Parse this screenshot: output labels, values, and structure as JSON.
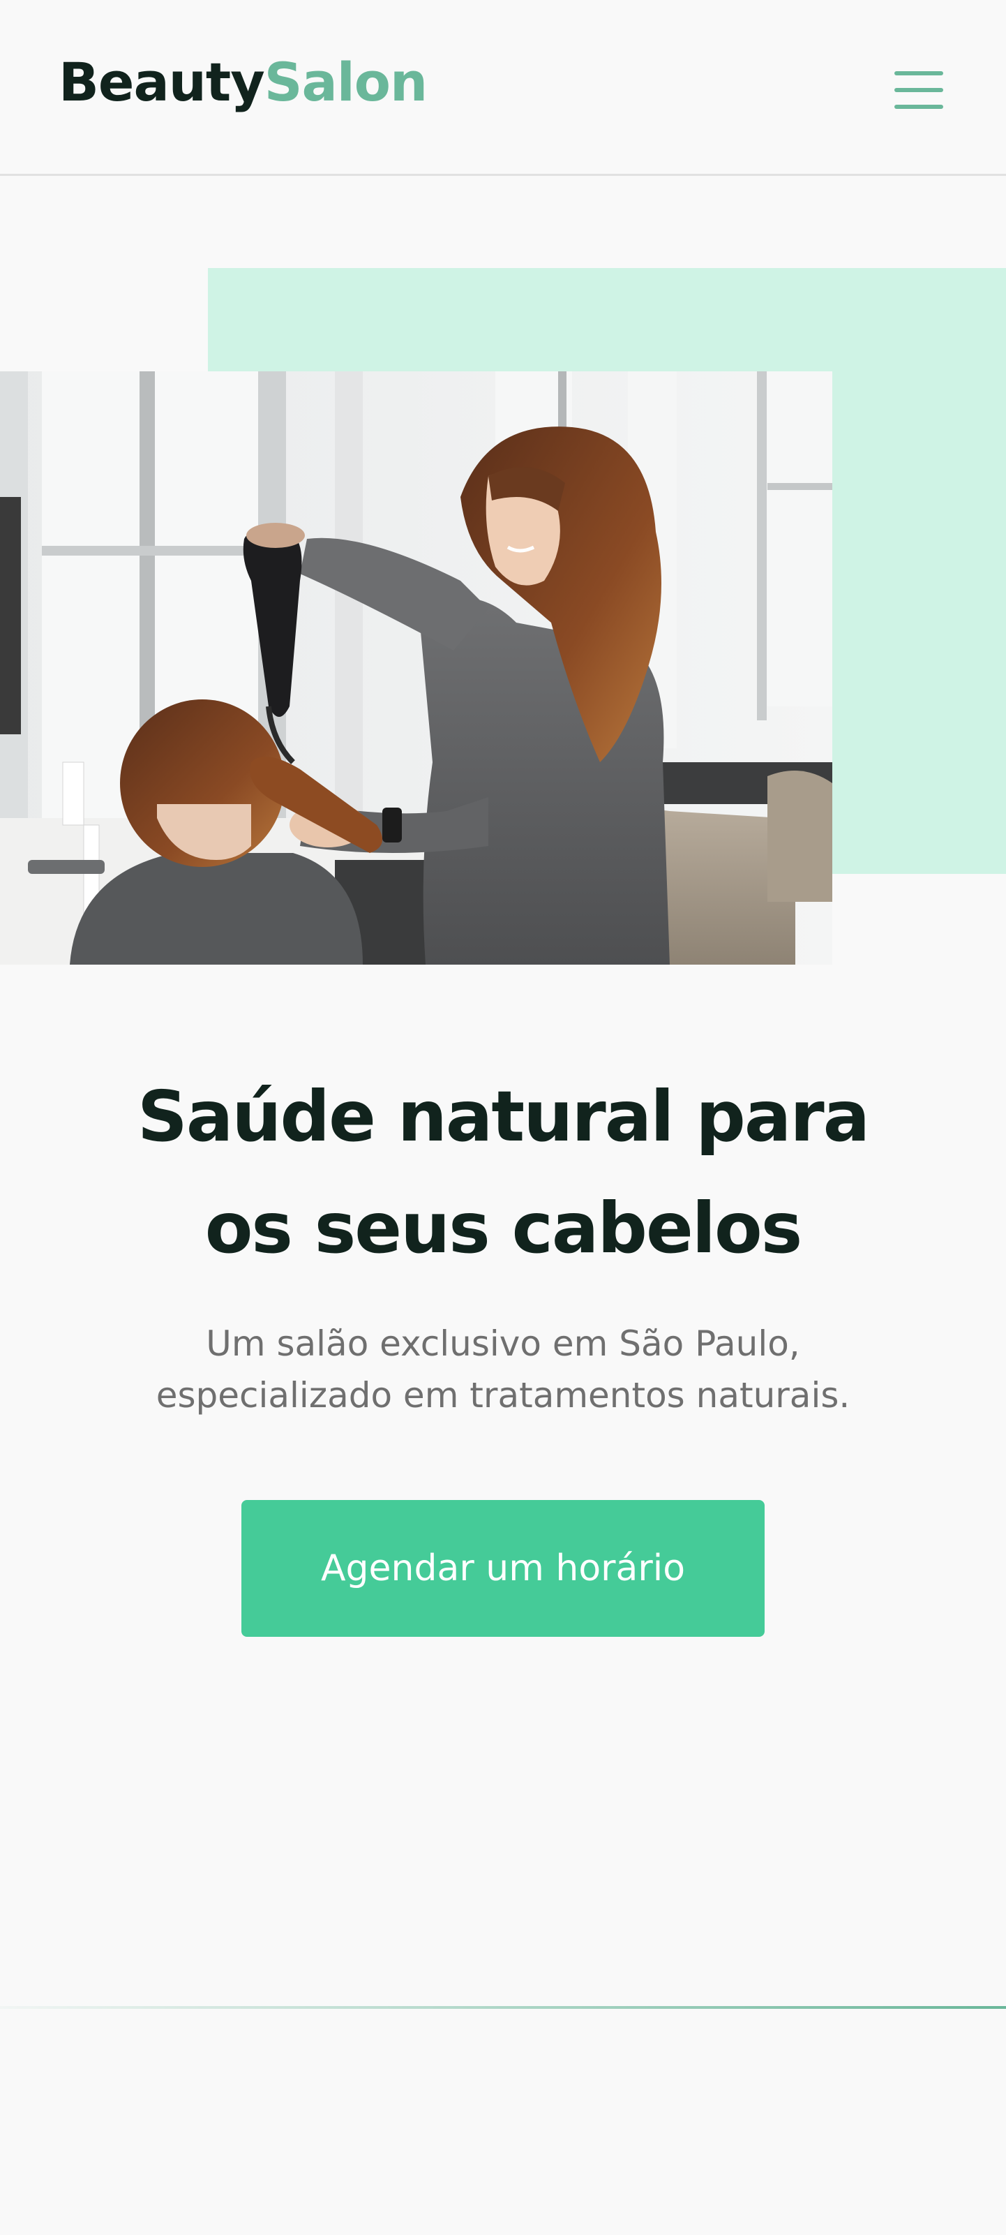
{
  "header": {
    "logo_part1": "Beauty",
    "logo_part2": "Salon"
  },
  "icons": {
    "menu": "hamburger-menu-icon"
  },
  "hero": {
    "image_alt": "Cabeleireira secando o cabelo de uma cliente no salão",
    "headline_line1": "Saúde natural para",
    "headline_line2": "os seus cabelos",
    "subtitle_line1": "Um salão exclusivo em São Paulo,",
    "subtitle_line2": "especializado em tratamentos naturais.",
    "cta_label": "Agendar um horário"
  },
  "colors": {
    "brand_dark": "#11231d",
    "brand_green": "#6ab79a",
    "accent_mint": "#cff3e5",
    "button": "#45cb98",
    "background": "#f9f9f9",
    "text_muted": "#6f6f6f"
  }
}
